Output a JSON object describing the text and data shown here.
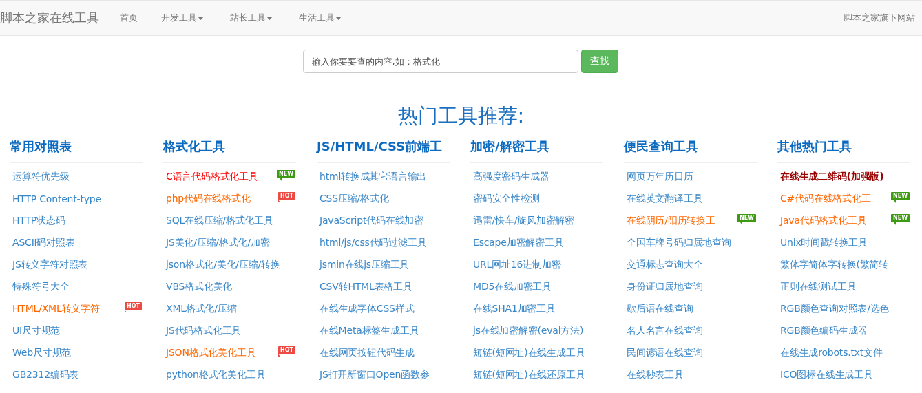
{
  "navbar": {
    "brand": "脚本之家在线工具",
    "items": [
      {
        "label": "首页",
        "dropdown": false
      },
      {
        "label": "开发工具",
        "dropdown": true
      },
      {
        "label": "站长工具",
        "dropdown": true
      },
      {
        "label": "生活工具",
        "dropdown": true
      }
    ],
    "right_link": "脚本之家旗下网站"
  },
  "search": {
    "placeholder": "输入你要要查的内容,如：格式化",
    "button": "查找"
  },
  "heading": "热门工具推荐:",
  "columns": [
    {
      "title": "常用对照表",
      "links": [
        {
          "label": "运算符优先级",
          "color": "#3a87c8",
          "kind": "normal"
        },
        {
          "label": "HTTP Content-type",
          "color": "#3a87c8",
          "kind": "normal"
        },
        {
          "label": "HTTP状态码",
          "color": "#3a87c8",
          "kind": "normal"
        },
        {
          "label": "ASCII码对照表",
          "color": "#3a87c8",
          "kind": "normal"
        },
        {
          "label": "JS转义字符对照表",
          "color": "#3a87c8",
          "kind": "normal"
        },
        {
          "label": "特殊符号大全",
          "color": "#3a87c8",
          "kind": "normal"
        },
        {
          "label": "HTML/XML转义字符",
          "color": "#ff6600",
          "kind": "normal",
          "badge": {
            "kind": "hot",
            "text": "HOT"
          }
        },
        {
          "label": "UI尺寸规范",
          "color": "#3a87c8",
          "kind": "normal"
        },
        {
          "label": "Web尺寸规范",
          "color": "#3a87c8",
          "kind": "normal"
        },
        {
          "label": "GB2312编码表",
          "color": "#3a87c8",
          "kind": "normal"
        }
      ]
    },
    {
      "title": "格式化工具",
      "links": [
        {
          "label": "C语言代码格式化工具",
          "color": "#ff0000",
          "kind": "normal",
          "badge": {
            "kind": "new",
            "text": "NEW"
          }
        },
        {
          "label": "php代码在线格式化",
          "color": "#ff6600",
          "kind": "normal",
          "badge": {
            "kind": "hot",
            "text": "HOT"
          }
        },
        {
          "label": "SQL在线压缩/格式化工具",
          "color": "#3a87c8",
          "kind": "normal"
        },
        {
          "label": "JS美化/压缩/格式化/加密",
          "color": "#3a87c8",
          "kind": "normal"
        },
        {
          "label": "json格式化/美化/压缩/转换",
          "color": "#3a87c8",
          "kind": "normal"
        },
        {
          "label": "VBS格式化美化",
          "color": "#3a87c8",
          "kind": "normal"
        },
        {
          "label": "XML格式化/压缩",
          "color": "#3a87c8",
          "kind": "normal"
        },
        {
          "label": "JS代码格式化工具",
          "color": "#3a87c8",
          "kind": "normal"
        },
        {
          "label": "JSON格式化美化工具",
          "color": "#ff6600",
          "kind": "normal",
          "badge": {
            "kind": "hot",
            "text": "HOT"
          }
        },
        {
          "label": "python格式化美化工具",
          "color": "#3a87c8",
          "kind": "normal"
        }
      ]
    },
    {
      "title": "JS/HTML/CSS前端工",
      "links": [
        {
          "label": "html转换成其它语言输出",
          "color": "#3a87c8",
          "kind": "normal"
        },
        {
          "label": "CSS压缩/格式化",
          "color": "#3a87c8",
          "kind": "normal"
        },
        {
          "label": "JavaScript代码在线加密",
          "color": "#3a87c8",
          "kind": "normal"
        },
        {
          "label": "html/js/css代码过滤工具",
          "color": "#3a87c8",
          "kind": "normal"
        },
        {
          "label": "jsmin在线js压缩工具",
          "color": "#3a87c8",
          "kind": "normal"
        },
        {
          "label": "CSV转HTML表格工具",
          "color": "#3a87c8",
          "kind": "normal"
        },
        {
          "label": "在线生成字体CSS样式",
          "color": "#3a87c8",
          "kind": "normal"
        },
        {
          "label": "在线Meta标签生成工具",
          "color": "#3a87c8",
          "kind": "normal"
        },
        {
          "label": "在线网页按钮代码生成",
          "color": "#3a87c8",
          "kind": "normal"
        },
        {
          "label": "JS打开新窗口Open函数参",
          "color": "#3a87c8",
          "kind": "normal"
        }
      ]
    },
    {
      "title": "加密/解密工具",
      "links": [
        {
          "label": "高强度密码生成器",
          "color": "#3a87c8",
          "kind": "normal"
        },
        {
          "label": "密码安全性检测",
          "color": "#3a87c8",
          "kind": "normal"
        },
        {
          "label": "迅雷/快车/旋风加密解密",
          "color": "#3a87c8",
          "kind": "normal"
        },
        {
          "label": "Escape加密解密工具",
          "color": "#3a87c8",
          "kind": "normal"
        },
        {
          "label": "URL网址16进制加密",
          "color": "#3a87c8",
          "kind": "normal"
        },
        {
          "label": "MD5在线加密工具",
          "color": "#3a87c8",
          "kind": "normal"
        },
        {
          "label": "在线SHA1加密工具",
          "color": "#3a87c8",
          "kind": "normal"
        },
        {
          "label": "js在线加密解密(eval方法)",
          "color": "#3a87c8",
          "kind": "normal"
        },
        {
          "label": "短链(短网址)在线生成工具",
          "color": "#3a87c8",
          "kind": "normal"
        },
        {
          "label": "短链(短网址)在线还原工具",
          "color": "#3a87c8",
          "kind": "normal"
        }
      ]
    },
    {
      "title": "便民查询工具",
      "links": [
        {
          "label": "网页万年历日历",
          "color": "#3a87c8",
          "kind": "normal"
        },
        {
          "label": "在线英文翻译工具",
          "color": "#3a87c8",
          "kind": "normal"
        },
        {
          "label": "在线阴历/阳历转换工",
          "color": "#ff6600",
          "kind": "normal",
          "badge": {
            "kind": "new",
            "text": "NEW"
          }
        },
        {
          "label": "全国车牌号码归属地查询",
          "color": "#3a87c8",
          "kind": "normal"
        },
        {
          "label": "交通标志查询大全",
          "color": "#3a87c8",
          "kind": "normal"
        },
        {
          "label": "身份证归属地查询",
          "color": "#3a87c8",
          "kind": "normal"
        },
        {
          "label": "歇后语在线查询",
          "color": "#3a87c8",
          "kind": "normal"
        },
        {
          "label": "名人名言在线查询",
          "color": "#3a87c8",
          "kind": "normal"
        },
        {
          "label": "民间谚语在线查询",
          "color": "#3a87c8",
          "kind": "normal"
        },
        {
          "label": "在线秒表工具",
          "color": "#3a87c8",
          "kind": "normal"
        }
      ]
    },
    {
      "title": "其他热门工具",
      "links": [
        {
          "label": "在线生成二维码(加强版)",
          "color": "#990000",
          "kind": "featured"
        },
        {
          "label": "C#代码在线格式化工",
          "color": "#ff6600",
          "kind": "normal",
          "badge": {
            "kind": "new",
            "text": "NEW"
          }
        },
        {
          "label": "Java代码格式化工具",
          "color": "#ff6600",
          "kind": "normal",
          "badge": {
            "kind": "new",
            "text": "NEW"
          }
        },
        {
          "label": "Unix时间戳转换工具",
          "color": "#3a87c8",
          "kind": "normal"
        },
        {
          "label": "繁体字简体字转换(繁简转",
          "color": "#3a87c8",
          "kind": "normal"
        },
        {
          "label": "正则在线测试工具",
          "color": "#3a87c8",
          "kind": "normal"
        },
        {
          "label": "RGB颜色查询对照表/选色",
          "color": "#3a87c8",
          "kind": "normal"
        },
        {
          "label": "RGB颜色编码生成器",
          "color": "#3a87c8",
          "kind": "normal"
        },
        {
          "label": "在线生成robots.txt文件",
          "color": "#3a87c8",
          "kind": "normal"
        },
        {
          "label": "ICO图标在线生成工具",
          "color": "#3a87c8",
          "kind": "normal"
        }
      ]
    }
  ]
}
